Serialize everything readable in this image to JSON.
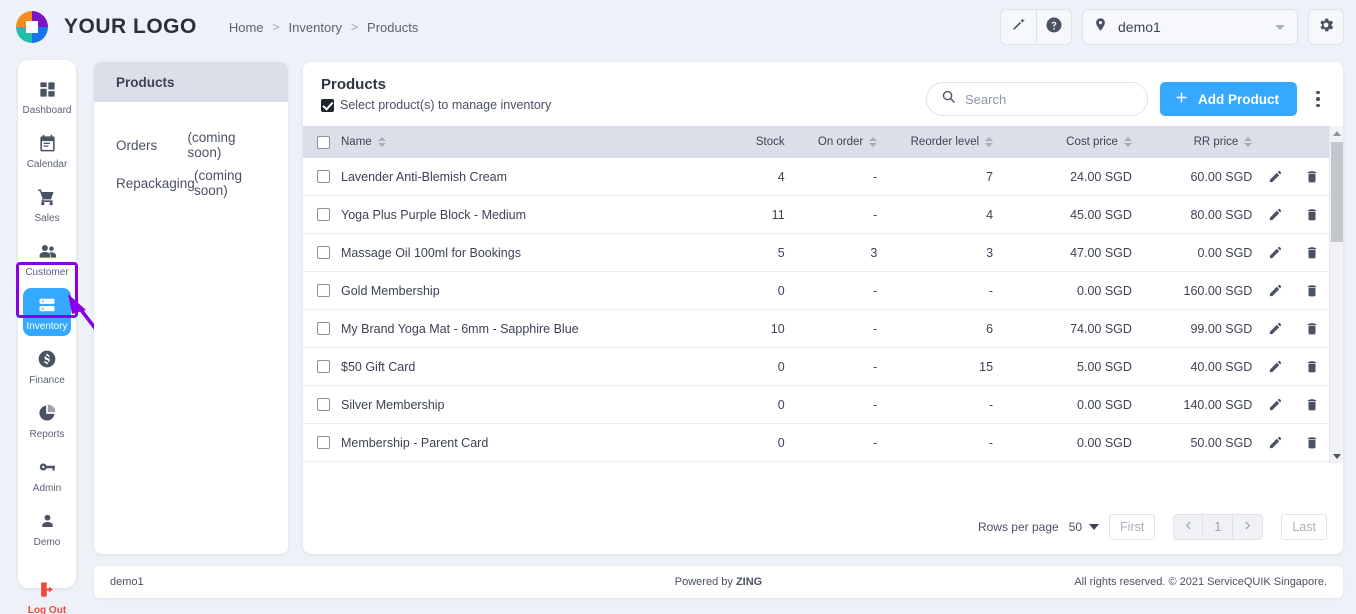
{
  "header": {
    "logo_text": "YOUR LOGO",
    "logo_icon": "pinwheel-logo-icon",
    "breadcrumb": [
      "Home",
      "Inventory",
      "Products"
    ],
    "separator": ">",
    "wand_icon": "magic-wand-icon",
    "help_icon": "help-circle-icon",
    "location_icon": "location-pin-icon",
    "location_value": "demo1",
    "settings_icon": "gear-icon"
  },
  "rail": {
    "items": [
      {
        "label": "Dashboard",
        "icon": "dashboard-grid-icon",
        "active": false
      },
      {
        "label": "Calendar",
        "icon": "calendar-icon",
        "active": false
      },
      {
        "label": "Sales",
        "icon": "shopping-cart-icon",
        "active": false
      },
      {
        "label": "Customer",
        "icon": "people-icon",
        "active": false
      },
      {
        "label": "Inventory",
        "icon": "server-stack-icon",
        "active": true
      },
      {
        "label": "Finance",
        "icon": "dollar-circle-icon",
        "active": false
      },
      {
        "label": "Reports",
        "icon": "pie-chart-icon",
        "active": false
      },
      {
        "label": "Admin",
        "icon": "key-icon",
        "active": false
      },
      {
        "label": "Demo",
        "icon": "person-icon",
        "active": false
      }
    ],
    "logout": {
      "label": "Log Out",
      "icon": "logout-icon",
      "color": "#f0483e"
    }
  },
  "subnav": {
    "selected": "Products",
    "rows": [
      {
        "name": "Orders",
        "note": "(coming soon)"
      },
      {
        "name": "Repackaging",
        "note": "(coming soon)"
      }
    ]
  },
  "panel": {
    "title": "Products",
    "subtitle": "Select product(s) to manage inventory",
    "search_placeholder": "Search",
    "search_value": "",
    "search_icon": "search-icon",
    "add_button": "Add Product",
    "add_icon": "plus-icon",
    "kebab_icon": "more-vertical-icon"
  },
  "table": {
    "columns": [
      {
        "label": "Name",
        "sortable": true
      },
      {
        "label": "Stock",
        "sortable": false
      },
      {
        "label": "On order",
        "sortable": true
      },
      {
        "label": "Reorder level",
        "sortable": true
      },
      {
        "label": "Cost price",
        "sortable": true
      },
      {
        "label": "RR price",
        "sortable": true
      }
    ],
    "edit_icon": "pencil-icon",
    "delete_icon": "trash-icon",
    "rows": [
      {
        "name": "Lavender Anti-Blemish Cream",
        "stock": "4",
        "on_order": "-",
        "reorder": "7",
        "cost": "24.00 SGD",
        "rr": "60.00 SGD"
      },
      {
        "name": "Yoga Plus Purple Block - Medium",
        "stock": "11",
        "on_order": "-",
        "reorder": "4",
        "cost": "45.00 SGD",
        "rr": "80.00 SGD"
      },
      {
        "name": "Massage Oil 100ml for Bookings",
        "stock": "5",
        "on_order": "3",
        "reorder": "3",
        "cost": "47.00 SGD",
        "rr": "0.00 SGD"
      },
      {
        "name": "Gold Membership",
        "stock": "0",
        "on_order": "-",
        "reorder": "-",
        "cost": "0.00 SGD",
        "rr": "160.00 SGD"
      },
      {
        "name": "My Brand Yoga Mat - 6mm - Sapphire Blue",
        "stock": "10",
        "on_order": "-",
        "reorder": "6",
        "cost": "74.00 SGD",
        "rr": "99.00 SGD"
      },
      {
        "name": "$50 Gift Card",
        "stock": "0",
        "on_order": "-",
        "reorder": "15",
        "cost": "5.00 SGD",
        "rr": "40.00 SGD"
      },
      {
        "name": "Silver Membership",
        "stock": "0",
        "on_order": "-",
        "reorder": "-",
        "cost": "0.00 SGD",
        "rr": "140.00 SGD"
      },
      {
        "name": "Membership - Parent Card",
        "stock": "0",
        "on_order": "-",
        "reorder": "-",
        "cost": "0.00 SGD",
        "rr": "50.00 SGD"
      }
    ]
  },
  "pager": {
    "rows_per_page_label": "Rows per page",
    "rows_per_page_value": "50",
    "first": "First",
    "prev_icon": "chevron-left-icon",
    "page": "1",
    "next_icon": "chevron-right-icon",
    "last": "Last"
  },
  "footer": {
    "left": "demo1",
    "mid_prefix": "Powered by ",
    "mid_brand": "ZING",
    "right": "All rights reserved. © 2021 ServiceQUIK Singapore."
  },
  "annotation": {
    "highlight_color": "#8a00e6",
    "target": "Inventory"
  }
}
